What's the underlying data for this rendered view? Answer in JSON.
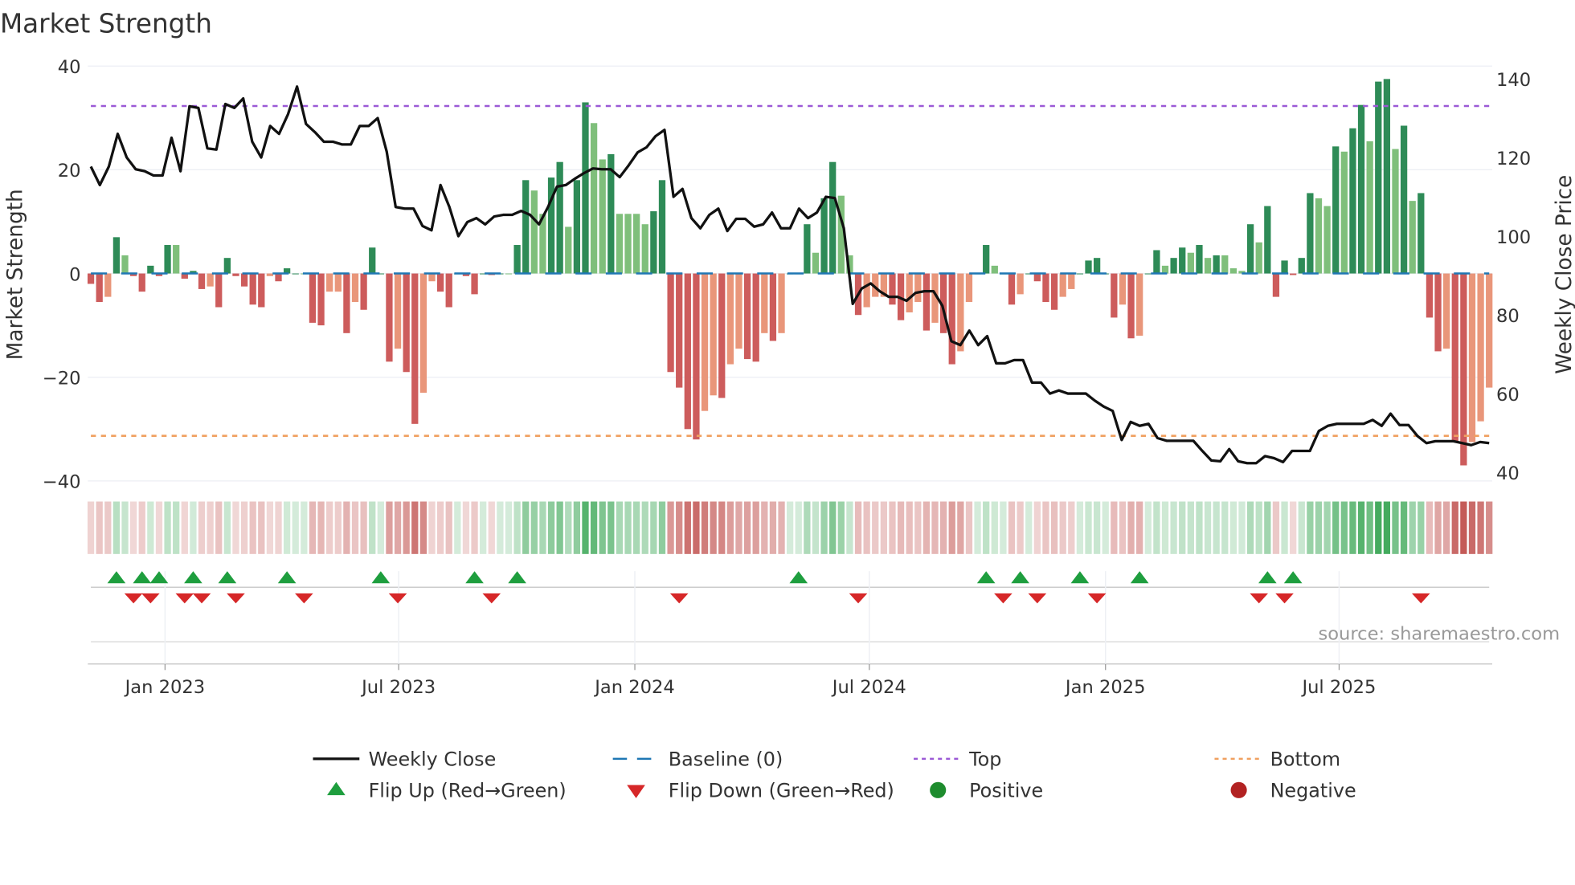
{
  "chart_data": {
    "type": "bar",
    "title": "Market Strength",
    "ylabel": "Market Strength",
    "y2label": "Weekly Close Price",
    "ylim": [
      -40,
      40
    ],
    "y2lim": [
      40,
      140
    ],
    "yticks": [
      "40",
      "20",
      "0",
      "−20",
      "−40"
    ],
    "ytick_values": [
      40,
      20,
      0,
      -20,
      -40
    ],
    "y2ticks": [
      "140",
      "120",
      "100",
      "80",
      "60",
      "40"
    ],
    "y2tick_values": [
      140,
      120,
      100,
      80,
      60,
      40
    ],
    "xticks": [
      {
        "label": "Jan 2023",
        "week": 8.7
      },
      {
        "label": "Jul 2023",
        "week": 36.1
      },
      {
        "label": "Jan 2024",
        "week": 63.8
      },
      {
        "label": "Jul 2024",
        "week": 91.3
      },
      {
        "label": "Jan 2025",
        "week": 119
      },
      {
        "label": "Jul 2025",
        "week": 146.4
      }
    ],
    "top_level": 32.3,
    "bottom_level": -31.3,
    "baseline": 0,
    "source": "source: sharemaestro.com",
    "colors": {
      "pos_strong": "#2e8b57",
      "pos_weak": "#7fbf7b",
      "neg_strong": "#cd5c5c",
      "neg_weak": "#e9967a",
      "price": "#111111",
      "baseline": "#1f77b4",
      "top": "#9b59d6",
      "bottom": "#f0a060",
      "flip_up": "#1e9e3e",
      "flip_down": "#d62728",
      "positive": "#1e8c2e",
      "negative": "#b22222"
    },
    "series": [
      {
        "name": "Market Strength",
        "values": [
          -2,
          -5.5,
          -4.5,
          7,
          3.5,
          -0.5,
          -3.5,
          1.5,
          -0.5,
          5.5,
          5.5,
          -1,
          0.5,
          -3,
          -2.5,
          -6.5,
          3,
          -0.5,
          -2.5,
          -6,
          -6.5,
          -0.5,
          -1.5,
          1,
          0,
          0,
          -9.5,
          -10,
          -3.5,
          -3.5,
          -11.5,
          -5.5,
          -7,
          5,
          0,
          -17,
          -14.5,
          -19,
          -29,
          -23,
          -1.5,
          -3.5,
          -6.5,
          0,
          -0.5,
          -4,
          0,
          -0.3,
          0,
          0,
          5.5,
          18,
          16,
          11.5,
          18.5,
          21.5,
          9,
          18,
          33,
          29,
          22,
          23,
          11.5,
          11.5,
          11.5,
          9.5,
          12,
          18,
          -19,
          -22,
          -30,
          -32,
          -26.5,
          -23.5,
          -24,
          -17.5,
          -14.5,
          -16.5,
          -17,
          -11.5,
          -13,
          -11.5,
          0,
          0,
          9.5,
          4,
          14.5,
          21.5,
          15,
          3.5,
          -8,
          -6.5,
          -4.5,
          -4.5,
          -6,
          -9,
          -7.5,
          -5.5,
          -11,
          -9.5,
          -11.5,
          -17.5,
          -15,
          -5.5,
          0,
          5.5,
          1.5,
          0,
          -6,
          -4,
          0,
          -1.5,
          -5.5,
          -7,
          -4.5,
          -3,
          0,
          2.5,
          3,
          0,
          -8.5,
          -6,
          -12.5,
          -12,
          0,
          4.5,
          1.5,
          3,
          5,
          4,
          5.5,
          3,
          3.5,
          3.5,
          1,
          0.5,
          9.5,
          6,
          13,
          -4.5,
          2.5,
          -0.3,
          3,
          15.5,
          14.5,
          13,
          24.5,
          23.5,
          28,
          32.5,
          25.5,
          37,
          37.5,
          24,
          28.5,
          14,
          15.5,
          -8.5,
          -15,
          -14.5,
          -32.5,
          -37,
          -32.5,
          -28.5,
          -22
        ]
      },
      {
        "name": "Weekly Close",
        "values": [
          117.7,
          113,
          117.7,
          126,
          120,
          117,
          116.5,
          115.4,
          115.4,
          125,
          116.5,
          133,
          132.6,
          122.3,
          122,
          133.6,
          132.6,
          135,
          124,
          120,
          128,
          126,
          131,
          138,
          128.5,
          126.4,
          124,
          124,
          123.3,
          123.3,
          128,
          128,
          130,
          121.5,
          107.4,
          107,
          107,
          102.6,
          101.5,
          113,
          107.4,
          100,
          103.6,
          104.6,
          103,
          105,
          105.4,
          105.4,
          106.4,
          105.4,
          103,
          107.4,
          112.6,
          113,
          114.6,
          116,
          117.2,
          117,
          117,
          115,
          118,
          121.3,
          122.6,
          125.4,
          127,
          110,
          112,
          104.6,
          102,
          105.4,
          107,
          101.3,
          104.4,
          104.4,
          102.4,
          103,
          106,
          102,
          102,
          107,
          104.6,
          106,
          110,
          109.7,
          102,
          82.8,
          86.7,
          88,
          86,
          84.6,
          84.6,
          83.6,
          85.6,
          86,
          86,
          82.3,
          73.3,
          72.3,
          76,
          72.3,
          74.6,
          67.7,
          67.7,
          68.5,
          68.5,
          62.8,
          62.8,
          60,
          60.8,
          60,
          60,
          60,
          58.2,
          56.7,
          55.6,
          48.2,
          52.8,
          51.8,
          52.3,
          48.7,
          48,
          48,
          48,
          48,
          45.4,
          43,
          42.8,
          45.9,
          42.8,
          42.3,
          42.3,
          44.1,
          43.6,
          42.6,
          45.4,
          45.4,
          45.4,
          50.5,
          51.8,
          52.3,
          52.3,
          52.3,
          52.3,
          53.3,
          51.8,
          54.9,
          52,
          52,
          49.2,
          47.4,
          47.9,
          47.9,
          47.9,
          47.4,
          46.9,
          47.7,
          47.4
        ]
      }
    ],
    "flip_up_weeks": [
      3,
      6,
      8,
      12,
      16,
      23,
      34,
      45,
      50,
      83,
      105,
      109,
      116,
      123,
      138,
      141
    ],
    "flip_down_weeks": [
      5,
      7,
      11,
      13,
      17,
      25,
      36,
      47,
      69,
      90,
      107,
      111,
      118,
      137,
      140,
      156
    ],
    "legend": {
      "placement": "bottom",
      "items": [
        {
          "label": "Weekly Close",
          "kind": "line"
        },
        {
          "label": "Baseline (0)",
          "kind": "dash"
        },
        {
          "label": "Top",
          "kind": "dot-top"
        },
        {
          "label": "Bottom",
          "kind": "dot-bottom"
        },
        {
          "label": "Flip Up (Red→Green)",
          "kind": "tri-up"
        },
        {
          "label": "Flip Down (Green→Red)",
          "kind": "tri-down"
        },
        {
          "label": "Positive",
          "kind": "circle-pos"
        },
        {
          "label": "Negative",
          "kind": "circle-neg"
        }
      ]
    }
  }
}
